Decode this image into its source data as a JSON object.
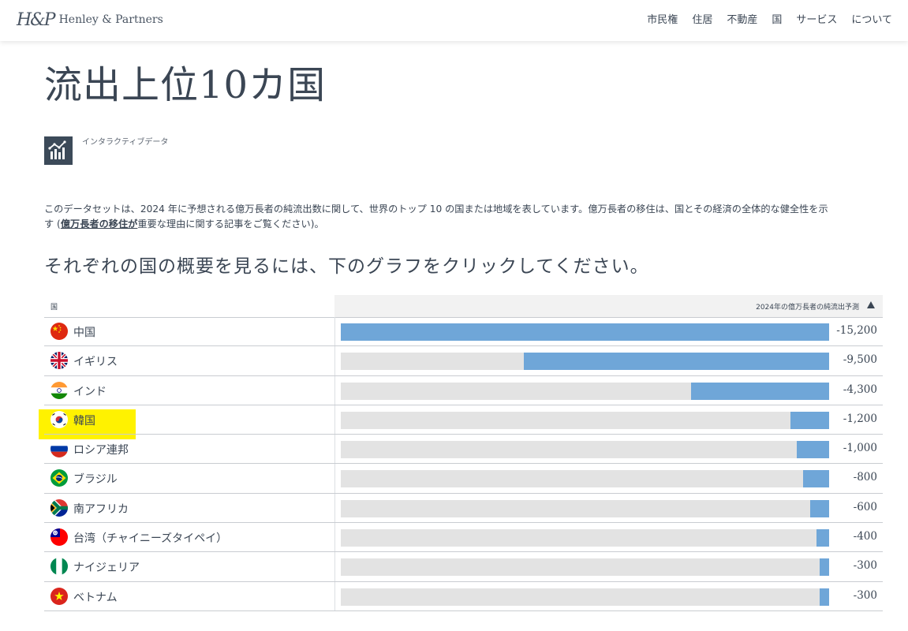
{
  "header": {
    "logo_mark": "H&P",
    "logo_text": "Henley & Partners",
    "nav": [
      "市民権",
      "住居",
      "不動産",
      "国",
      "サービス",
      "について"
    ]
  },
  "page_title": "流出上位10カ国",
  "data_icon_label": "インタラクティブデータ",
  "description": {
    "line1": "このデータセットは、2024 年に予想される億万長者の純流出数に関して、世界のトップ 10 の国または地域を表しています。億万長者の移住は、国とその経済の全体的な健全性を示",
    "line2_prefix": "す (",
    "link_text": "億万長者の移住が",
    "line2_suffix": "重要な理由に関する記事をご覧ください)。"
  },
  "subheading": "それぞれの国の概要を見るには、下のグラフをクリックしてください。",
  "table": {
    "col_country": "国",
    "col_value": "2024年の億万長者の純流出予測"
  },
  "colors": {
    "bar_fill": "#6fa6d8",
    "bar_track": "#e3e3e3",
    "highlight": "#fff200"
  },
  "chart_data": {
    "type": "bar",
    "categories": [
      "中国",
      "イギリス",
      "インド",
      "韓国",
      "ロシア連邦",
      "ブラジル",
      "南アフリカ",
      "台湾（チャイニーズタイペイ）",
      "ナイジェリア",
      "ベトナム"
    ],
    "values": [
      -15200,
      -9500,
      -4300,
      -1200,
      -1000,
      -800,
      -600,
      -400,
      -300,
      -300
    ],
    "value_labels": [
      "-15,200",
      "-9,500",
      "-4,300",
      "-1,200",
      "-1,000",
      "-800",
      "-600",
      "-400",
      "-300",
      "-300"
    ],
    "flag_icons": [
      "china-flag-icon",
      "uk-flag-icon",
      "india-flag-icon",
      "south-korea-flag-icon",
      "russia-flag-icon",
      "brazil-flag-icon",
      "south-africa-flag-icon",
      "taiwan-flag-icon",
      "nigeria-flag-icon",
      "vietnam-flag-icon"
    ],
    "highlighted": "韓国",
    "ylim": [
      -15200,
      0
    ]
  }
}
